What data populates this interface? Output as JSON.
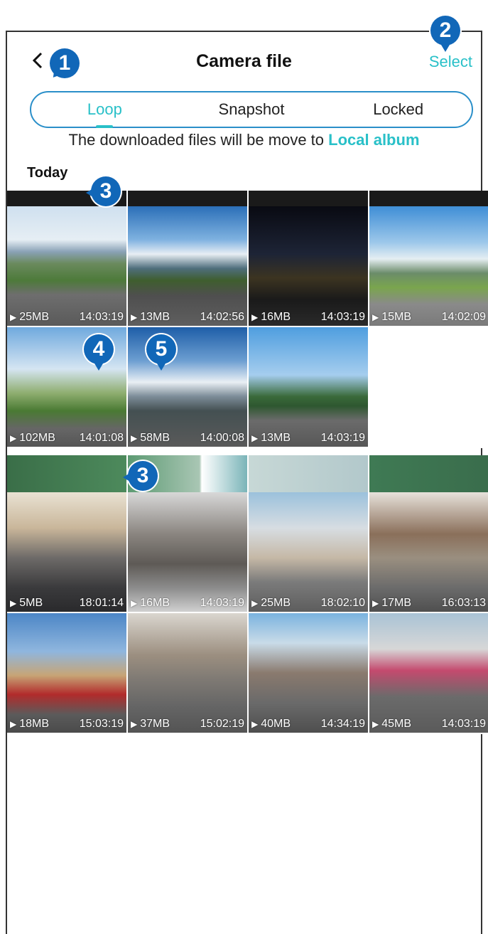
{
  "header": {
    "title": "Camera file",
    "select_label": "Select"
  },
  "callouts": [
    "1",
    "2",
    "3",
    "4",
    "5"
  ],
  "tabs": [
    {
      "label": "Loop",
      "active": true
    },
    {
      "label": "Snapshot",
      "active": false
    },
    {
      "label": "Locked",
      "active": false
    }
  ],
  "notice": {
    "text": "The downloaded files will be move to ",
    "link": "Local album"
  },
  "section": {
    "label": "Today"
  },
  "colors": {
    "accent": "#29c0c8",
    "callout": "#1167b8",
    "tab_border": "#2a8fc9"
  },
  "group1": [
    {
      "size": "25MB",
      "time": "14:03:19",
      "scene": "mountain"
    },
    {
      "size": "13MB",
      "time": "14:02:56",
      "scene": "sky"
    },
    {
      "size": "16MB",
      "time": "14:03:19",
      "scene": "night"
    },
    {
      "size": "15MB",
      "time": "14:02:09",
      "scene": "alps"
    },
    {
      "size": "102MB",
      "time": "14:01:08",
      "scene": "highway"
    },
    {
      "size": "58MB",
      "time": "14:00:08",
      "scene": "snow"
    },
    {
      "size": "13MB",
      "time": "14:03:19",
      "scene": "forest"
    }
  ],
  "group2": [
    {
      "size": "5MB",
      "time": "18:01:14",
      "scene": "sunset"
    },
    {
      "size": "16MB",
      "time": "14:03:19",
      "scene": "city1"
    },
    {
      "size": "25MB",
      "time": "18:02:10",
      "scene": "city2"
    },
    {
      "size": "17MB",
      "time": "16:03:13",
      "scene": "city3"
    },
    {
      "size": "18MB",
      "time": "15:03:19",
      "scene": "london"
    },
    {
      "size": "37MB",
      "time": "15:02:19",
      "scene": "rain"
    },
    {
      "size": "40MB",
      "time": "14:34:19",
      "scene": "street"
    },
    {
      "size": "45MB",
      "time": "14:03:19",
      "scene": "square"
    }
  ]
}
